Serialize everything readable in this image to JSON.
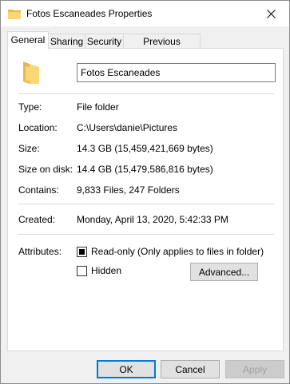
{
  "window": {
    "title": "Fotos Escaneades Properties",
    "close_icon": "close-icon",
    "title_icon": "folder-icon"
  },
  "tabs": [
    {
      "label": "General",
      "active": true
    },
    {
      "label": "Sharing",
      "active": false
    },
    {
      "label": "Security",
      "active": false
    },
    {
      "label": "Previous Versions",
      "active": false
    }
  ],
  "general": {
    "folder_name": "Fotos Escaneades",
    "type_label": "Type:",
    "type_value": "File folder",
    "location_label": "Location:",
    "location_value": "C:\\Users\\danie\\Pictures",
    "size_label": "Size:",
    "size_value": "14.3 GB (15,459,421,669 bytes)",
    "size_on_disk_label": "Size on disk:",
    "size_on_disk_value": "14.4 GB (15,479,586,816 bytes)",
    "contains_label": "Contains:",
    "contains_value": "9,833 Files, 247 Folders",
    "created_label": "Created:",
    "created_value": "Monday, April 13, 2020, 5:42:33 PM",
    "attributes_label": "Attributes:",
    "readonly_label": "Read-only (Only applies to files in folder)",
    "readonly_checked": true,
    "hidden_label": "Hidden",
    "hidden_checked": false,
    "advanced_label": "Advanced..."
  },
  "buttons": {
    "ok_label": "OK",
    "cancel_label": "Cancel",
    "apply_label": "Apply"
  },
  "colors": {
    "folder_yellow": "#f8d775",
    "accent_blue": "#0078d7"
  }
}
